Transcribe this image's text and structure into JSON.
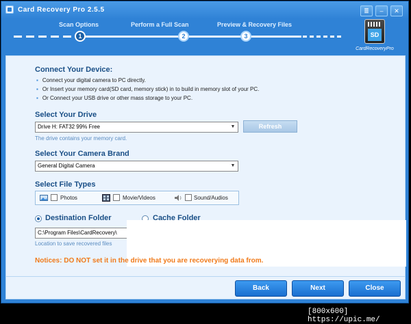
{
  "window": {
    "title": "Card Recovery Pro 2.5.5",
    "controls": {
      "menu": "≣",
      "minimize": "–",
      "close": "✕"
    }
  },
  "steps": [
    {
      "label": "Scan Options",
      "number": "1",
      "state": "active"
    },
    {
      "label": "Perform a Full Scan",
      "number": "2",
      "state": "pending"
    },
    {
      "label": "Preview & Recovery Files",
      "number": "3",
      "state": "pending"
    }
  ],
  "logo": {
    "card_text": "SD",
    "caption": "CardRecoveryPro"
  },
  "connect": {
    "title": "Connect Your Device:",
    "bullets": [
      "Connect your digital camera to PC directly.",
      "Or Insert your memory card(SD card, memory stick) in to build in memory slot of your PC.",
      "Or Connect your USB drive or other mass storage to your PC."
    ]
  },
  "drive": {
    "title": "Select Your Drive",
    "selected": "Drive H: FAT32 99% Free",
    "refresh_label": "Refresh",
    "hint": "The drive contains your memory card."
  },
  "camera": {
    "title": "Select Your Camera Brand",
    "selected": "General Digital Camera"
  },
  "file_types": {
    "title": "Select File Types",
    "items": [
      {
        "label": "Photos",
        "checked": false,
        "icon": "photo-icon"
      },
      {
        "label": "Movie/Videos",
        "checked": false,
        "icon": "film-icon"
      },
      {
        "label": "Sound/Audios",
        "checked": false,
        "icon": "speaker-icon"
      }
    ]
  },
  "folder": {
    "destination_label": "Destination Folder",
    "cache_label": "Cache Folder",
    "destination_value": "C:\\Program Files\\CardRecovery\\",
    "hint": "Location to save recovered files"
  },
  "notice": "Notices: DO NOT set it in the drive that you are recoverying data from.",
  "buttons": {
    "back": "Back",
    "next": "Next",
    "close": "Close"
  },
  "watermark": "[800x600] https://upic.me/",
  "colors": {
    "accent": "#2f82d6",
    "notice": "#f07a1a",
    "button": "#1a6fd0"
  }
}
